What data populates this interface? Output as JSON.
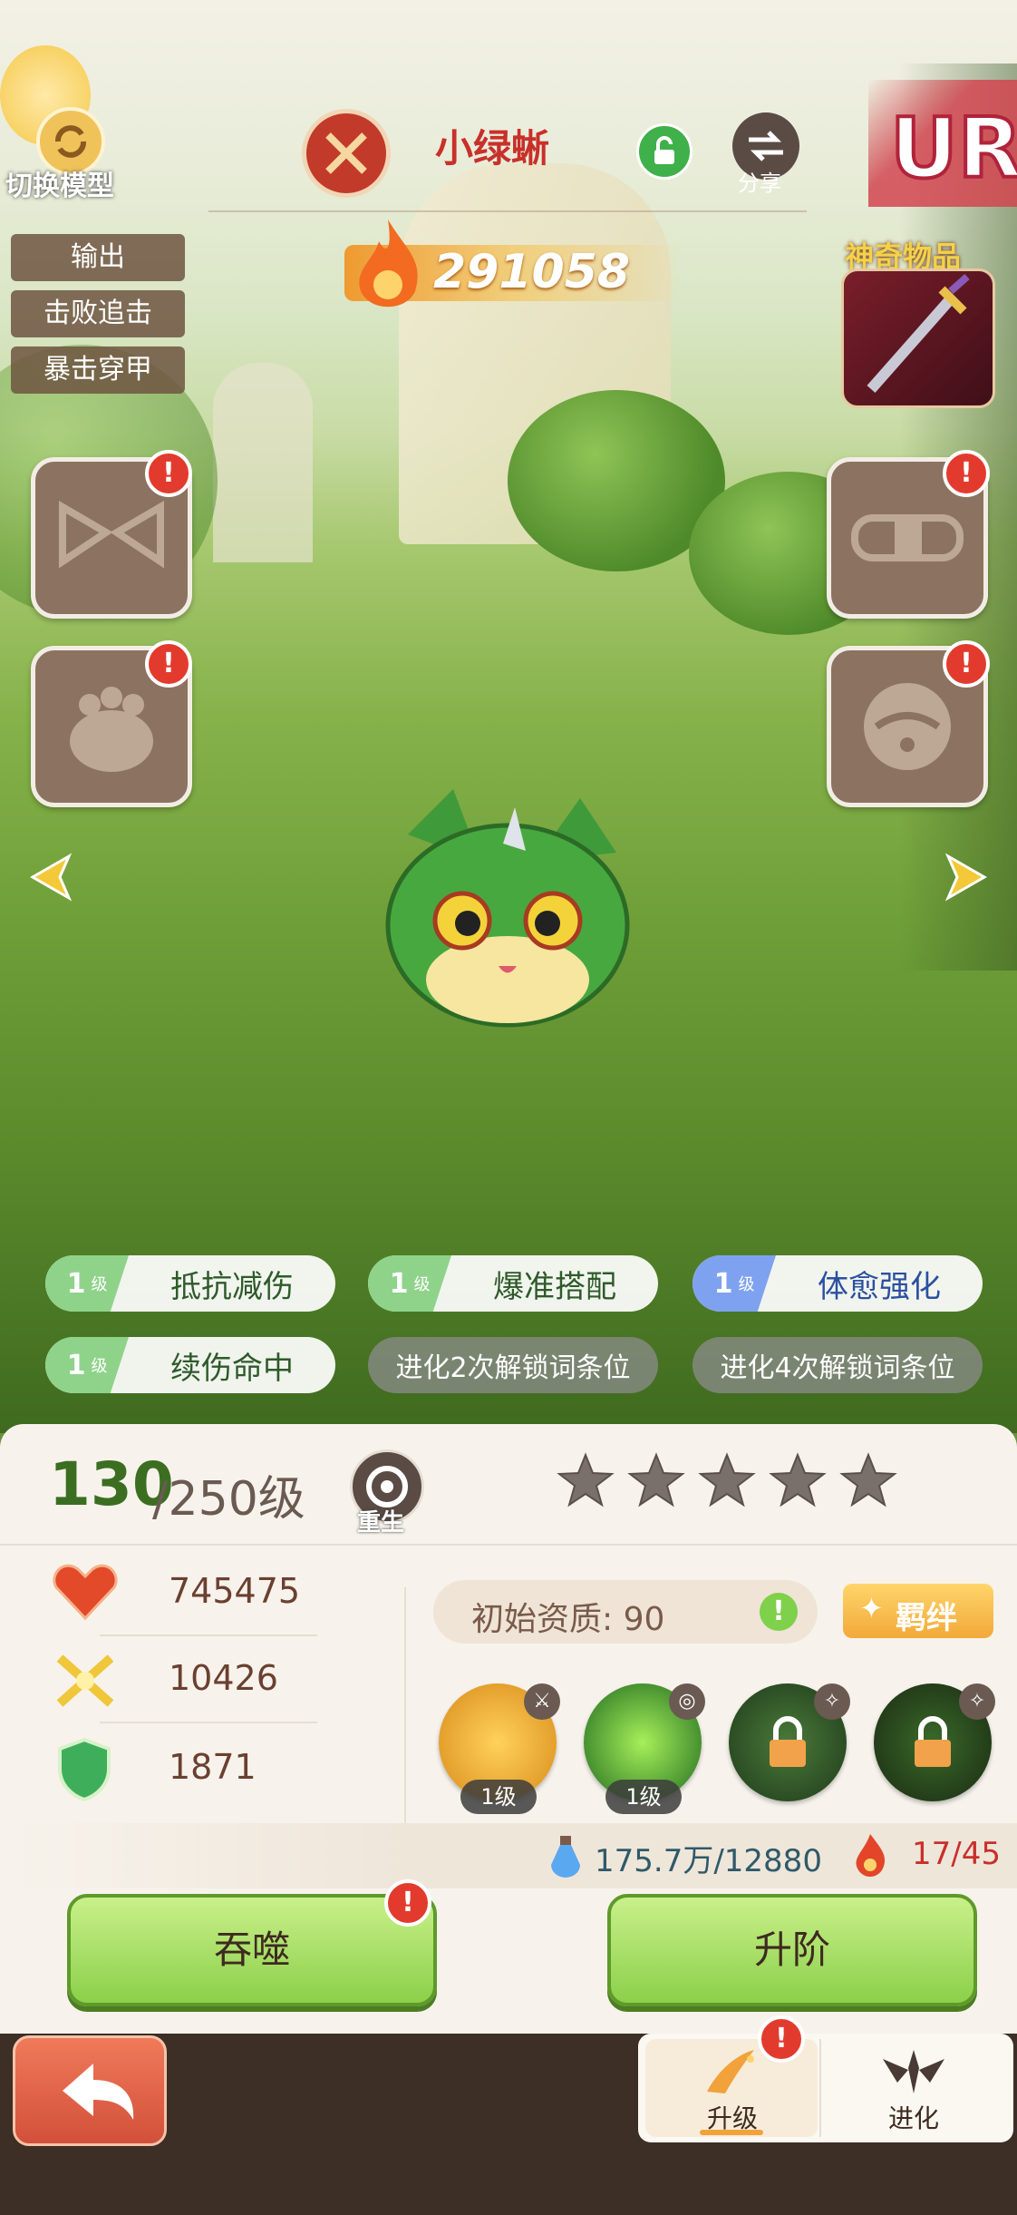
{
  "header": {
    "switch_model_label": "切换模型",
    "pet_name": "小绿蜥",
    "share_label": "分享",
    "rarity": "UR",
    "power": "291058",
    "magic_item_label": "神奇物品"
  },
  "role_tags": [
    "输出",
    "击败追击",
    "暴击穿甲"
  ],
  "traits": [
    {
      "level": "1",
      "unit": "级",
      "name": "抵抗减伤",
      "style": "green"
    },
    {
      "level": "1",
      "unit": "级",
      "name": "爆准搭配",
      "style": "green"
    },
    {
      "level": "1",
      "unit": "级",
      "name": "体愈强化",
      "style": "blue"
    },
    {
      "level": "1",
      "unit": "级",
      "name": "续伤命中",
      "style": "green"
    },
    {
      "name": "进化2次解锁词条位",
      "style": "locked"
    },
    {
      "name": "进化4次解锁词条位",
      "style": "locked"
    }
  ],
  "level": {
    "current": "130",
    "max_text": "/250级",
    "rebirth_label": "重生",
    "stars_filled": 0,
    "stars_total": 5
  },
  "stats": {
    "hp": "745475",
    "attack": "10426",
    "defense": "1871"
  },
  "aptitude": {
    "label": "初始资质: 90",
    "bond_label": "羁绊"
  },
  "skills": [
    {
      "level_label": "1级",
      "locked": false
    },
    {
      "level_label": "1级",
      "locked": false
    },
    {
      "level_label": "",
      "locked": true
    },
    {
      "level_label": "",
      "locked": true
    }
  ],
  "resources": {
    "exp": "175.7万/12880",
    "essence": "17/45"
  },
  "actions": {
    "devour_label": "吞噬",
    "ascend_label": "升阶"
  },
  "tabs": [
    {
      "label": "升级"
    },
    {
      "label": "进化"
    }
  ],
  "colors": {
    "accent_green": "#8bd04a",
    "alert_red": "#e23b2e",
    "name_red": "#c8302a"
  }
}
